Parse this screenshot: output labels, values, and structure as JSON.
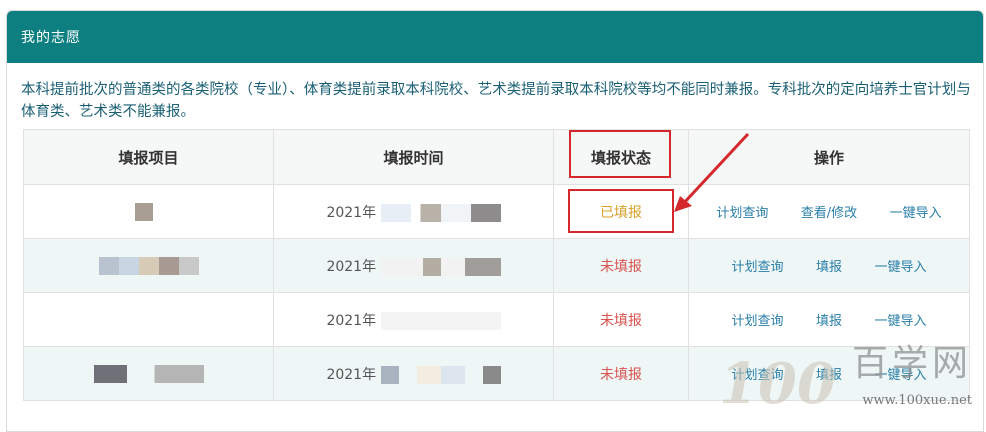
{
  "panel": {
    "title": "我的志愿"
  },
  "notice": "本科提前批次的普通类的各类院校（专业）、体育类提前录取本科院校、艺术类提前录取本科院校等均不能同时兼报。专科批次的定向培养士官计划与体育类、艺术类不能兼报。",
  "table": {
    "headers": [
      "填报项目",
      "填报时间",
      "填报状态",
      "操作"
    ],
    "rows": [
      {
        "year": "2021年",
        "status": "已填报",
        "actions": [
          "计划查询",
          "查看/修改",
          "一键导入"
        ]
      },
      {
        "year": "2021年",
        "status": "未填报",
        "actions": [
          "计划查询",
          "填报",
          "一键导入"
        ]
      },
      {
        "year": "2021年",
        "status": "未填报",
        "actions": [
          "计划查询",
          "填报",
          "一键导入"
        ]
      },
      {
        "year": "2021年",
        "status": "未填报",
        "actions": [
          "计划查询",
          "填报",
          "一键导入"
        ]
      }
    ]
  },
  "watermark": {
    "logo": "100",
    "name": "百学网",
    "url": "www.100xue.net"
  },
  "colors": {
    "header_bg": "#0e7f80",
    "notice_text": "#1a5f74",
    "filled": "#d8a128",
    "unfilled": "#d9534f",
    "highlight": "#d5282c"
  }
}
